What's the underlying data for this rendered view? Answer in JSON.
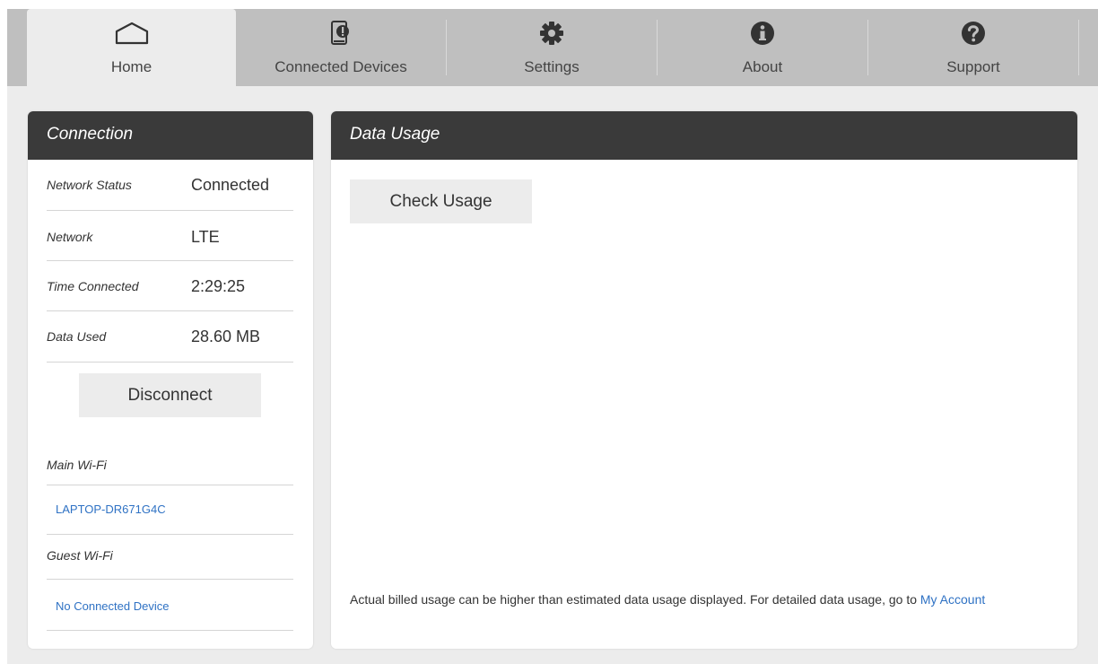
{
  "nav": {
    "tabs": [
      {
        "label": "Home",
        "icon": "home-icon"
      },
      {
        "label": "Connected Devices",
        "icon": "connected-devices-icon"
      },
      {
        "label": "Settings",
        "icon": "gear-icon"
      },
      {
        "label": "About",
        "icon": "info-icon"
      },
      {
        "label": "Support",
        "icon": "help-icon"
      }
    ],
    "active": "Home"
  },
  "connection": {
    "title": "Connection",
    "rows": [
      {
        "key": "Network Status",
        "value": "Connected"
      },
      {
        "key": "Network",
        "value": "LTE"
      },
      {
        "key": "Time Connected",
        "value": "2:29:25"
      },
      {
        "key": "Data Used",
        "value": "28.60 MB"
      }
    ],
    "disconnect_label": "Disconnect",
    "main_wifi": {
      "label": "Main Wi-Fi",
      "device": "LAPTOP-DR671G4C"
    },
    "guest_wifi": {
      "label": "Guest Wi-Fi",
      "device": "No Connected Device"
    }
  },
  "usage": {
    "title": "Data Usage",
    "check_label": "Check Usage",
    "note": "Actual billed usage can be higher than estimated data usage displayed. For detailed data usage, go to",
    "account_link": "My Account"
  },
  "colors": {
    "header_bg": "#3a3a3a",
    "nav_bg": "#bfbfbf",
    "link": "#2f72c4"
  }
}
